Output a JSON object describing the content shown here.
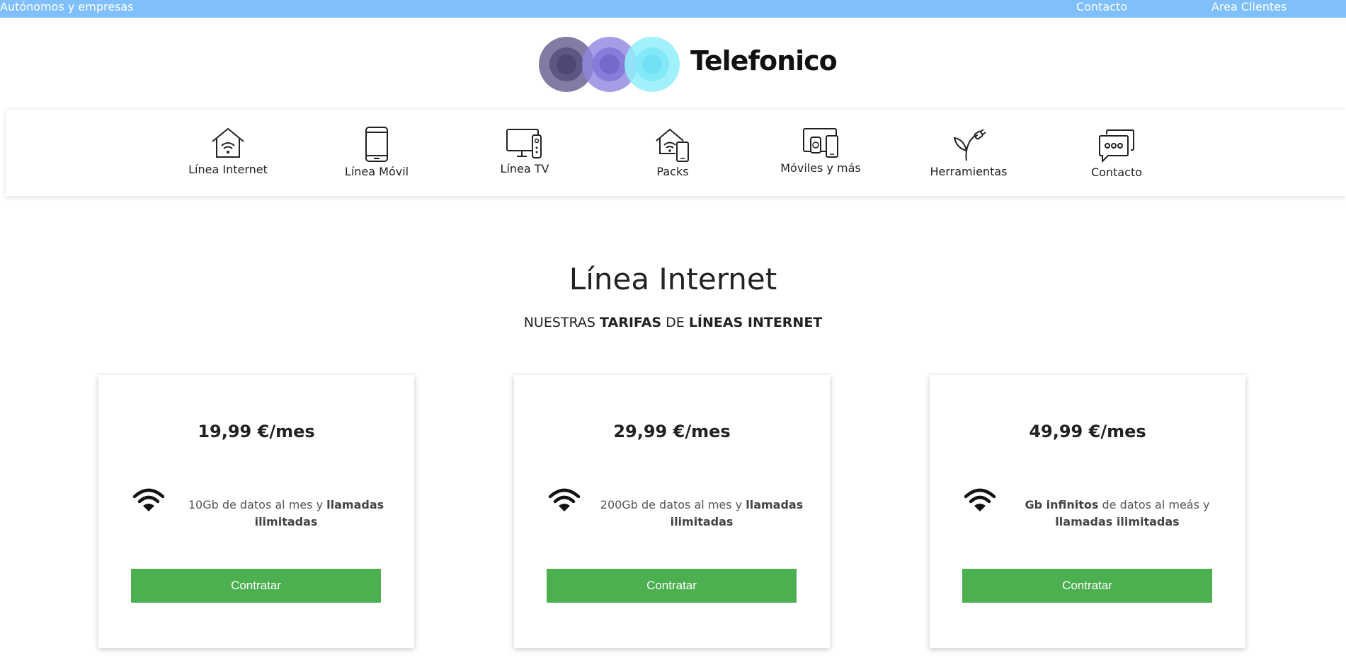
{
  "topbar": {
    "left_link": "Autónomos y empresas",
    "contact_link": "Contacto",
    "client_area_link": "Area Clientes",
    "color": "#7fbffc"
  },
  "brand": {
    "name": "Telefonico",
    "circle_colors": [
      "#6a6593",
      "#8e84e0",
      "#7ee8f7"
    ]
  },
  "nav": {
    "items": [
      {
        "label": "Línea Internet",
        "icon": "house-wifi-icon"
      },
      {
        "label": "Línea Móvil",
        "icon": "smartphone-icon"
      },
      {
        "label": "Línea TV",
        "icon": "tv-remote-icon"
      },
      {
        "label": "Packs",
        "icon": "house-phone-icon"
      },
      {
        "label": "Móviles y más",
        "icon": "devices-icon"
      },
      {
        "label": "Herramientas",
        "icon": "plant-plug-icon"
      },
      {
        "label": "Contacto",
        "icon": "chat-bubbles-icon"
      }
    ]
  },
  "main": {
    "title": "Línea Internet",
    "subtitle": {
      "p1": "NUESTRAS ",
      "b1": "TARIFAS",
      "p2": " DE ",
      "b2": "LÍNEAS INTERNET"
    }
  },
  "plans": [
    {
      "price": "19,99 €/mes",
      "icon": "wifi-icon",
      "desc_a": "10Gb de datos al mes y ",
      "desc_b": "llamadas ilimitadas",
      "desc_c": "",
      "button": "Contratar"
    },
    {
      "price": "29,99 €/mes",
      "icon": "wifi-icon",
      "desc_a": "200Gb de datos al mes y ",
      "desc_b": "llamadas ilimitadas",
      "desc_c": "",
      "button": "Contratar"
    },
    {
      "price": "49,99 €/mes",
      "icon": "wifi-icon",
      "desc_a": "Gb infinitos",
      "desc_b": " de datos al meás y ",
      "desc_c": "llamadas ilimitadas",
      "button": "Contratar"
    }
  ],
  "colors": {
    "button": "#4caf50",
    "topbar": "#7fbffc"
  }
}
